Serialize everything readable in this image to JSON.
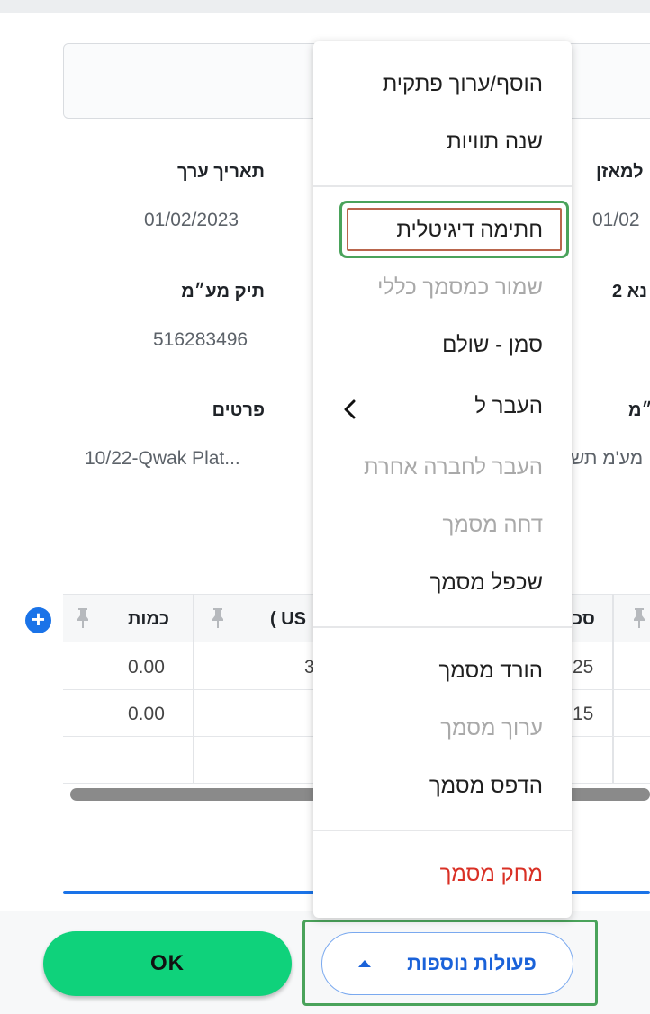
{
  "fields": {
    "due_date_label": "תאריך ערך",
    "due_date_value": "01/02/2023",
    "balance_label_partial": "למאזן",
    "balance_value_partial": "01/02",
    "vat_file_label": "תיק מע״מ",
    "vat_file_value": "516283496",
    "field2_label_partial": "נא 2",
    "details_label": "פרטים",
    "details_value": "10/22-Qwak Plat...",
    "vat_label_partial": "״מ",
    "vat_value_partial": "מע'מ תש"
  },
  "table": {
    "headers": {
      "quantity": "כמות",
      "usd_partial": "( US",
      "sum_partial": "סכ"
    },
    "rows": [
      {
        "quantity": "0.00",
        "usd_partial": "3",
        "sum_partial": "25"
      },
      {
        "quantity": "0.00",
        "usd_partial": "",
        "sum_partial": "15"
      },
      {
        "quantity": "",
        "usd_partial": "",
        "sum_partial": ""
      }
    ]
  },
  "context_menu": {
    "items": [
      {
        "label": "הוסף/ערוך פתקית",
        "disabled": false
      },
      {
        "label": "שנה תוויות",
        "disabled": false
      },
      {
        "label": "חתימה דיגיטלית",
        "disabled": false,
        "highlighted": true
      },
      {
        "label": "שמור כמסמך כללי",
        "disabled": true
      },
      {
        "label": "סמן - שולם",
        "disabled": false
      },
      {
        "label": "העבר ל",
        "disabled": false,
        "submenu": true
      },
      {
        "label": "העבר לחברה אחרת",
        "disabled": true
      },
      {
        "label": "דחה מסמך",
        "disabled": true
      },
      {
        "label": "שכפל מסמך",
        "disabled": false
      },
      {
        "label": "הורד מסמך",
        "disabled": false
      },
      {
        "label": "ערוך מסמך",
        "disabled": true
      },
      {
        "label": "הדפס מסמך",
        "disabled": false
      },
      {
        "label": "מחק מסמך",
        "disabled": false,
        "danger": true
      }
    ]
  },
  "footer": {
    "ok_label": "OK",
    "more_actions_label": "פעולות נוספות"
  },
  "colors": {
    "accent_blue": "#1a73e8",
    "ok_green": "#0fd27b",
    "highlight_green": "#4aa35b",
    "danger_red": "#d93025",
    "disabled_gray": "#a9a9a9"
  }
}
